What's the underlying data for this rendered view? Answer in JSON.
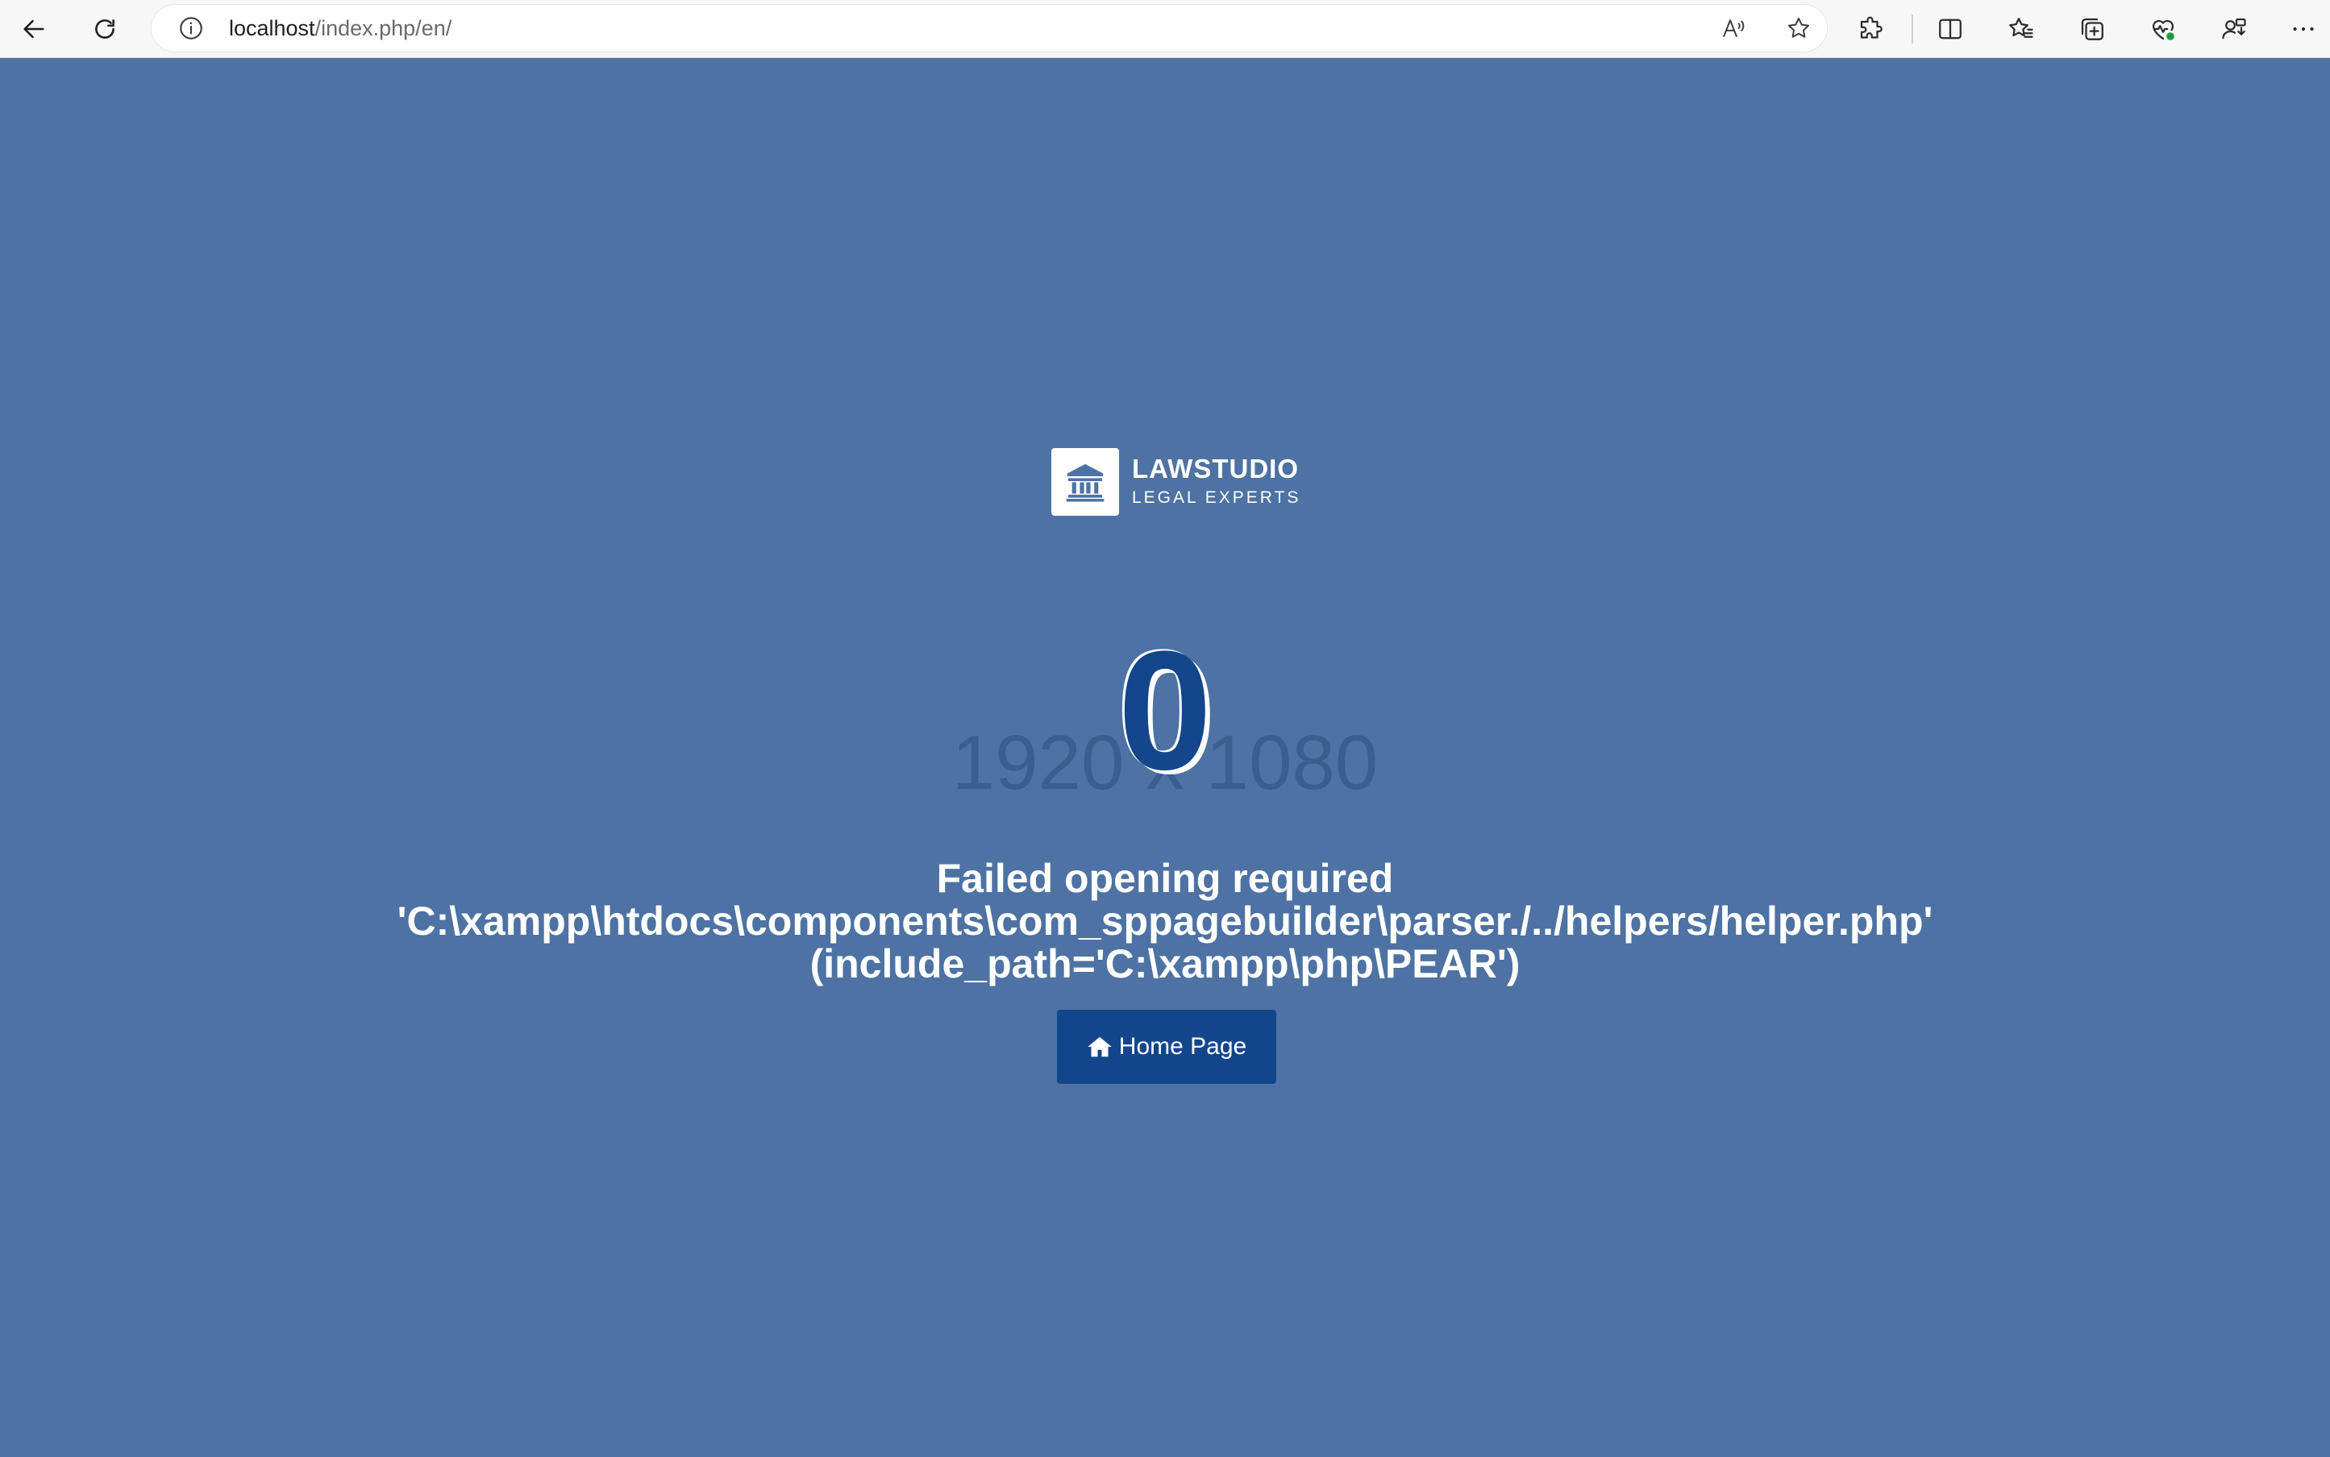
{
  "browser": {
    "url_host": "localhost",
    "url_path": "/index.php/en/",
    "icons": [
      "back-icon",
      "refresh-icon",
      "site-info-icon",
      "read-aloud-icon",
      "favorite-star-icon",
      "extensions-icon",
      "split-screen-icon",
      "favorites-icon",
      "collections-icon",
      "browser-essentials-icon",
      "profile-sync-icon",
      "more-menu-icon"
    ]
  },
  "logo": {
    "title": "LAWSTUDIO",
    "subtitle": "LEGAL EXPERTS",
    "icon": "courthouse-icon"
  },
  "error": {
    "code": "0",
    "placeholder_size": "1920 x 1080",
    "message": "Failed opening required 'C:\\xampp\\htdocs\\components\\com_sppagebuilder\\parser./../helpers/helper.php' (include_path='C:\\xampp\\php\\PEAR')"
  },
  "home_button": {
    "label": "Home Page",
    "icon": "home-icon"
  },
  "colors": {
    "page_background": "#4d72a3",
    "accent": "#12468c",
    "error_code": "#13468a",
    "text": "#ffffff"
  }
}
